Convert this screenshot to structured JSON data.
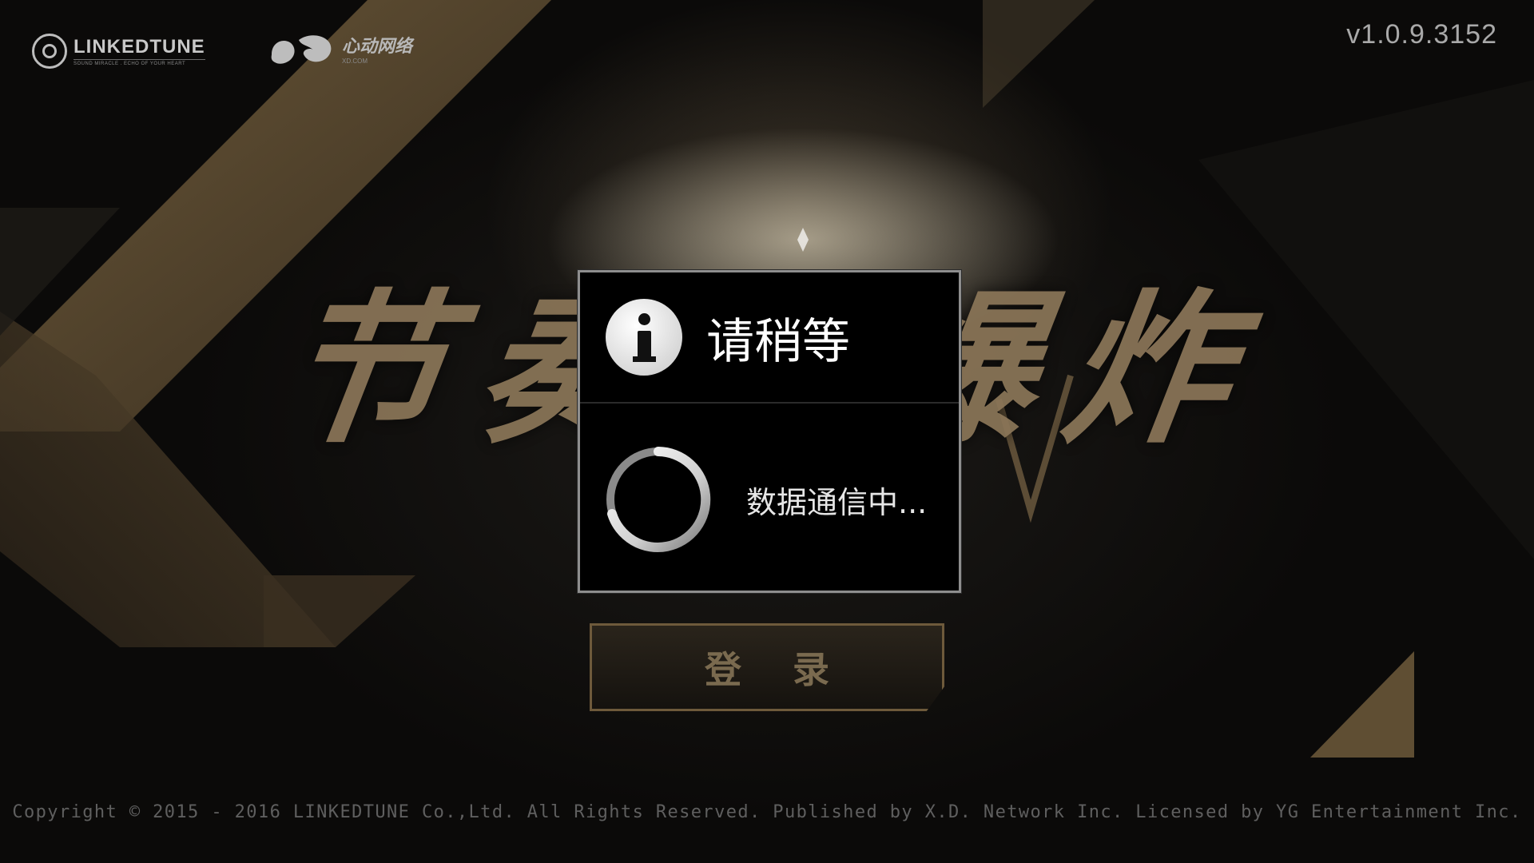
{
  "header": {
    "logo_linkedtune": {
      "name": "LINKEDTUNE",
      "slogan": "SOUND MIRACLE . ECHO OF YOUR HEART"
    },
    "logo_xd": {
      "name_cn": "心动网络",
      "name_en": "XD.COM"
    },
    "version": "v1.0.9.3152"
  },
  "game_title": "节奏大爆炸",
  "dialog": {
    "title": "请稍等",
    "message": "数据通信中...",
    "icon": "info-icon",
    "spinner_icon": "loading-spinner-icon"
  },
  "login_button": {
    "label": "登 录"
  },
  "footer": {
    "copyright": "Copyright © 2015 - 2016 LINKEDTUNE Co.,Ltd. All Rights Reserved. Published by X.D. Network Inc. Licensed by YG Entertainment Inc."
  },
  "colors": {
    "gold": "#8b7658",
    "background": "#0d0c0b",
    "dialog_border": "#8e8e8e"
  }
}
